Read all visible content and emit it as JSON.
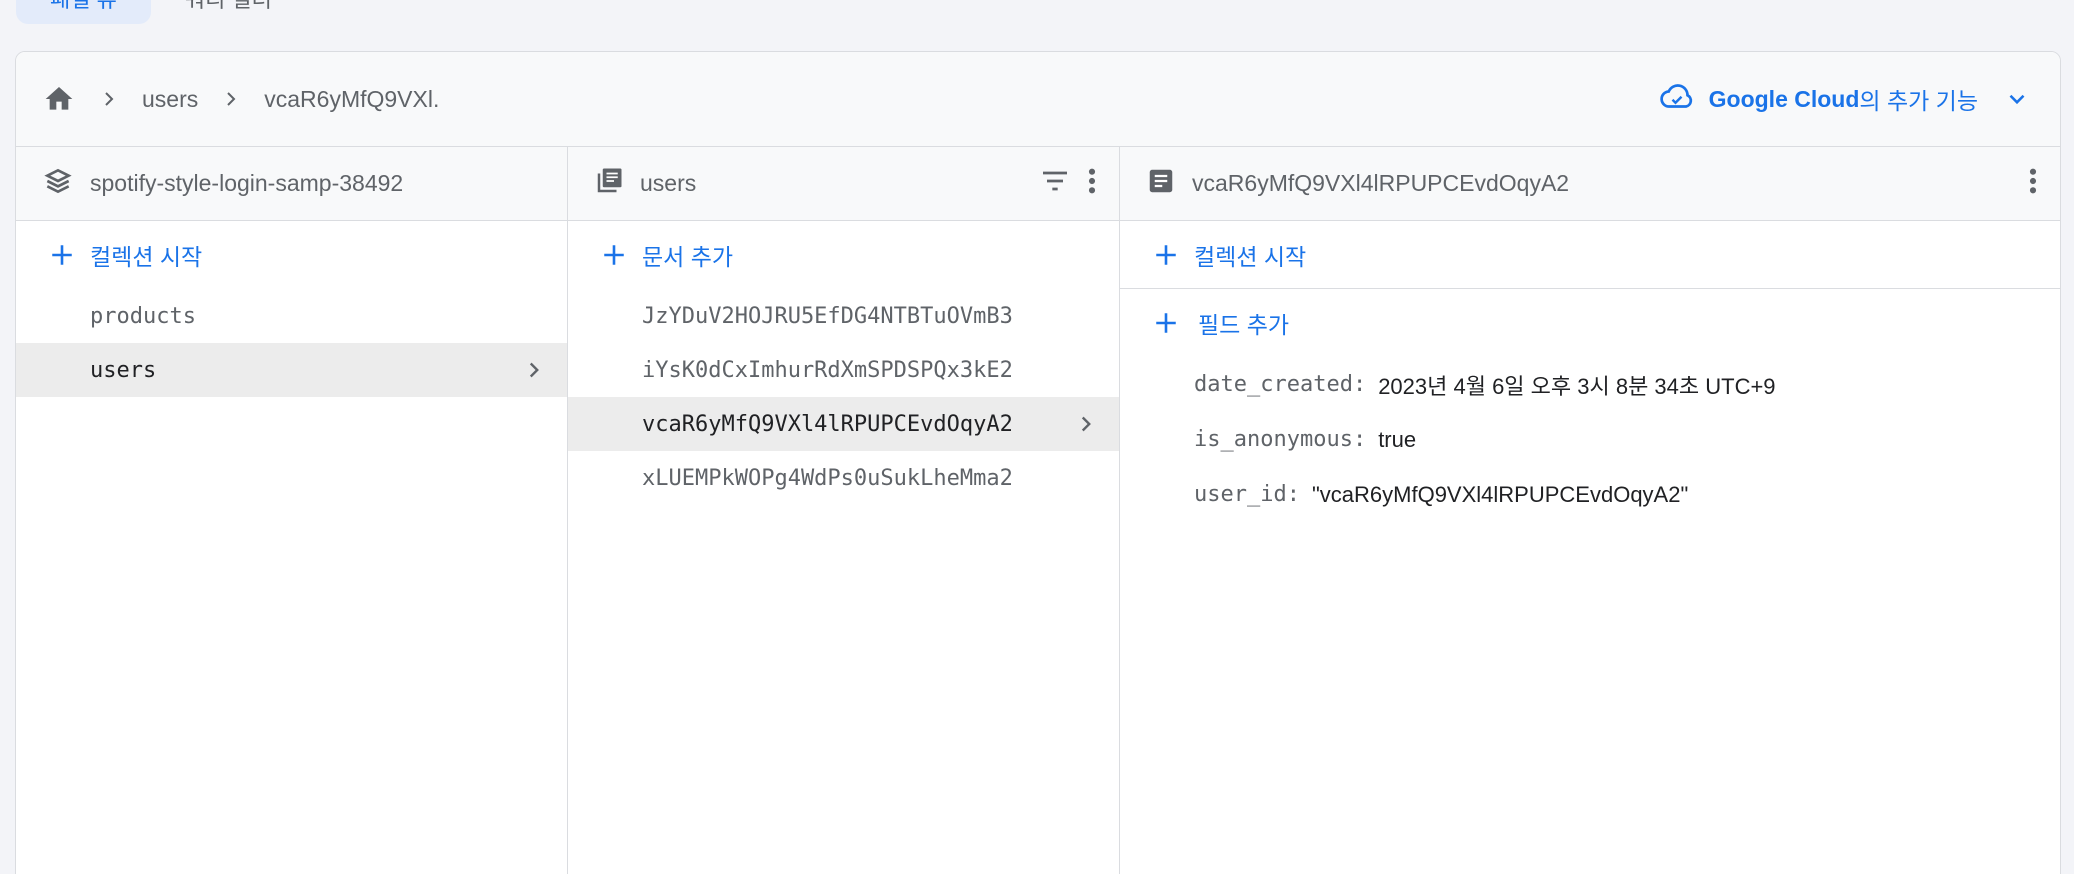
{
  "top_tabs": {
    "active": "패널 뷰",
    "other": "쿼리 빌더"
  },
  "breadcrumb": {
    "items": [
      "users",
      "vcaR6yMfQ9VXl."
    ]
  },
  "google_cloud": {
    "bold": "Google Cloud",
    "rest": "의 추가 기능"
  },
  "col1": {
    "title": "spotify-style-login-samp-38492",
    "add_label": "컬렉션 시작",
    "items": [
      "products",
      "users"
    ]
  },
  "col2": {
    "title": "users",
    "add_label": "문서 추가",
    "items": [
      "JzYDuV2HOJRU5EfDG4NTBTuOVmB3",
      "iYsK0dCxImhurRdXmSPDSPQx3kE2",
      "vcaR6yMfQ9VXl4lRPUPCEvdOqyA2",
      "xLUEMPkWOPg4WdPs0uSukLheMma2"
    ]
  },
  "col3": {
    "title": "vcaR6yMfQ9VXl4lRPUPCEvdOqyA2",
    "add_collection_label": "컬렉션 시작",
    "add_field_label": "필드 추가",
    "fields": [
      {
        "key": "date_created:",
        "value": "2023년 4월 6일 오후 3시 8분 34초 UTC+9"
      },
      {
        "key": "is_anonymous:",
        "value": "true"
      },
      {
        "key": "user_id:",
        "value": "\"vcaR6yMfQ9VXl4lRPUPCEvdOqyA2\""
      }
    ]
  },
  "colors": {
    "accent": "#1a73e8",
    "selected_bg": "#ececec",
    "header_bg": "#f8f9fa"
  }
}
